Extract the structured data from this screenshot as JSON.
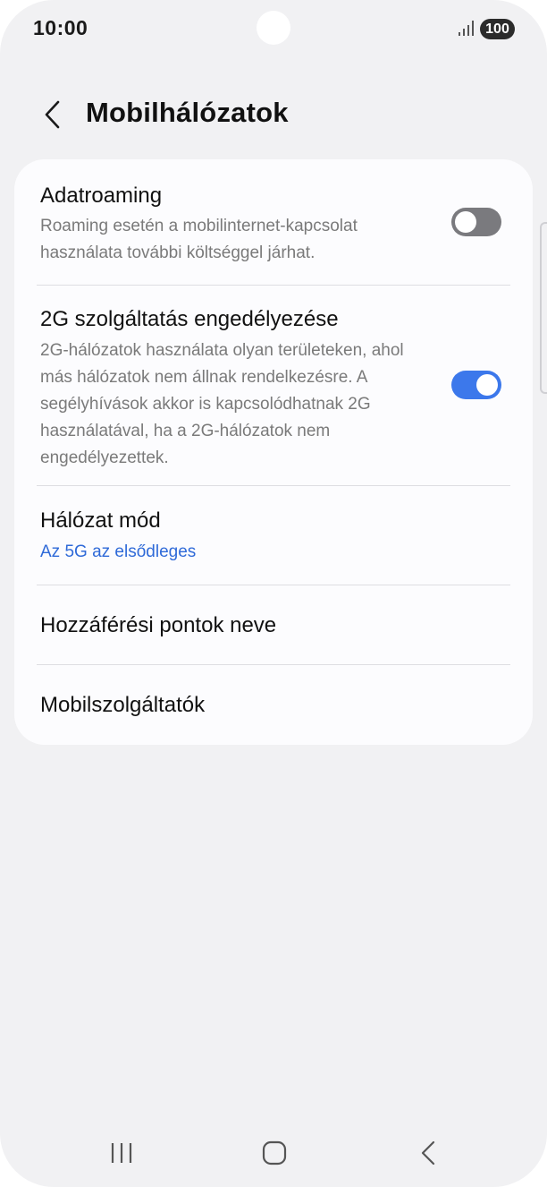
{
  "status_bar": {
    "time": "10:00",
    "battery": "100",
    "signal_icon": "signal-bars-icon"
  },
  "header": {
    "title": "Mobilhálózatok",
    "back_icon": "chevron-left-icon"
  },
  "settings": {
    "adatroaming": {
      "title": "Adatroaming",
      "description": "Roaming esetén a mobilinternet-kapcsolat használata további költséggel járhat.",
      "enabled": false
    },
    "g2": {
      "title": "2G szolgáltatás engedélyezése",
      "description": "2G-hálózatok használata olyan területeken, ahol más hálózatok nem állnak rendelkezésre. A segélyhívások akkor is kapcsolódhatnak 2G használatával, ha a 2G-hálózatok nem engedélyezettek.",
      "enabled": true
    },
    "network_mode": {
      "title": "Hálózat mód",
      "value": "Az 5G az elsődleges"
    },
    "apn": {
      "title": "Hozzáférési pontok neve"
    },
    "operators": {
      "title": "Mobilszolgáltatók"
    }
  },
  "navigation": {
    "recents_icon": "recents-icon",
    "home_icon": "home-icon",
    "back_icon": "back-icon"
  },
  "colors": {
    "accent": "#3c78eb",
    "link": "#2f6ad8",
    "background": "#f1f1f3",
    "card": "#fcfcfe",
    "toggle_off": "#7a7a7e"
  }
}
